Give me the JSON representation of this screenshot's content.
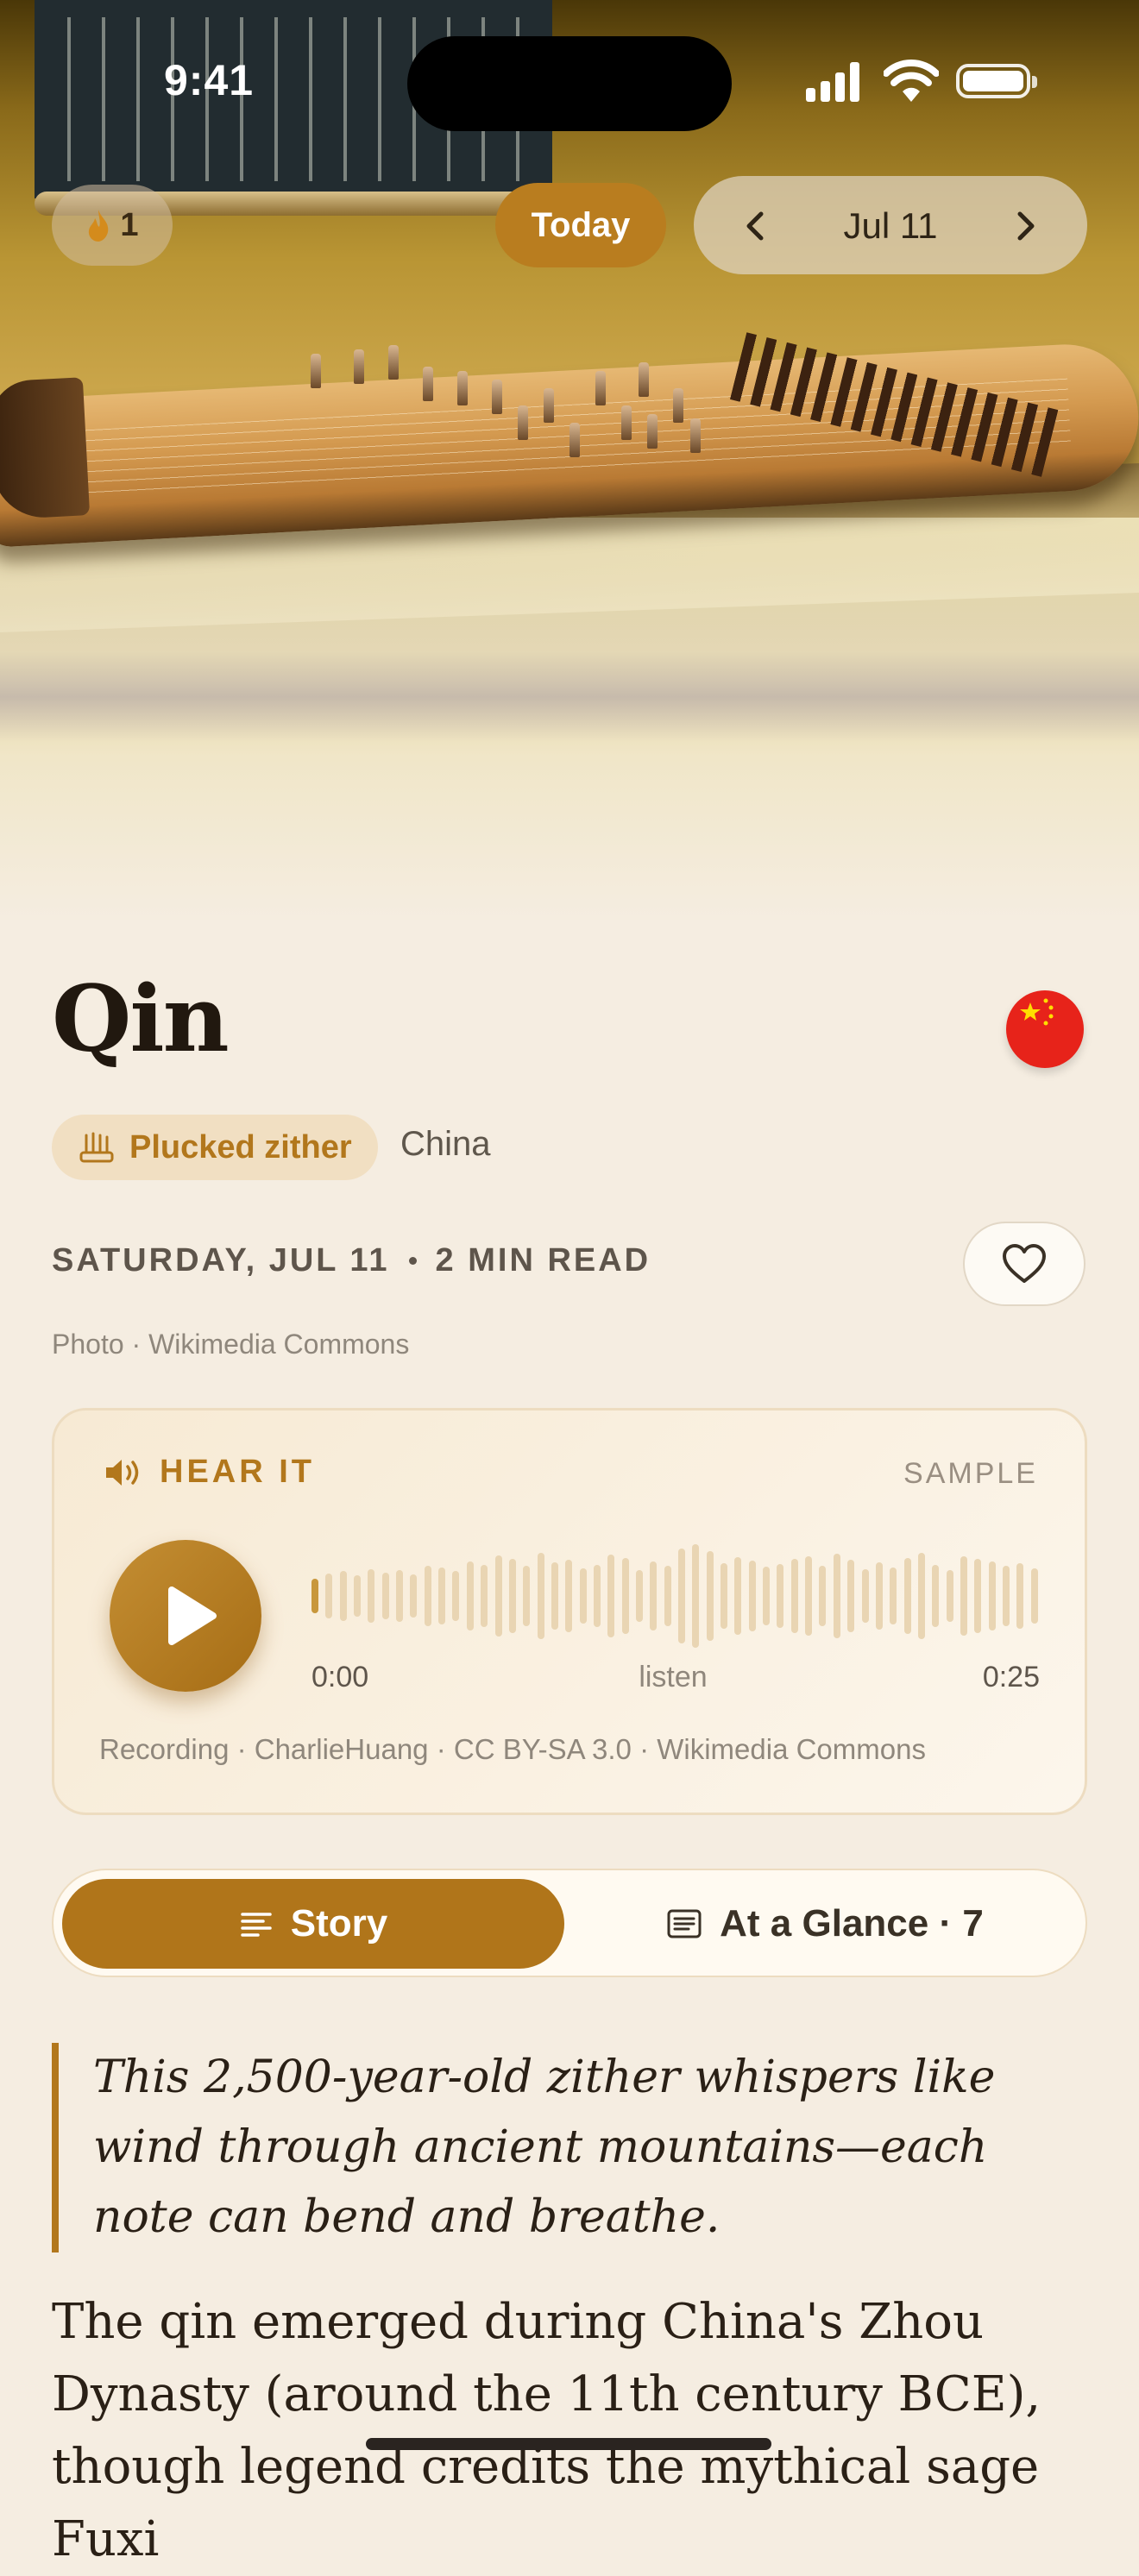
{
  "status_bar": {
    "time": "9:41"
  },
  "top_bar": {
    "streak_count": "1",
    "today_label": "Today",
    "date_label": "Jul 11"
  },
  "article": {
    "title": "Qin",
    "category": "Plucked zither",
    "country": "China",
    "flag": "china-flag",
    "date_line": "SATURDAY, JUL 11",
    "read_time": "2 MIN READ",
    "photo_credit": "Photo · Wikimedia Commons",
    "favorited": false
  },
  "audio": {
    "heading": "HEAR IT",
    "badge": "SAMPLE",
    "current_time": "0:00",
    "center_label": "listen",
    "duration": "0:25",
    "progress": 0.0,
    "attribution": "Recording · CharlieHuang · CC BY-SA 3.0 · Wikimedia Commons"
  },
  "tabs": {
    "story_label": "Story",
    "glance_label": "At a Glance · 7",
    "selected": "Story"
  },
  "story": {
    "pull_quote": "This 2,500-year-old zither whispers like wind through ancient mountains—each note can bend and breathe.",
    "paragraph": "The qin emerged during China's Zhou Dynasty (around the 11th century BCE), though legend credits the mythical sage Fuxi"
  },
  "colors": {
    "accent": "#b0751a",
    "background": "#f5ede1",
    "text": "#21180f"
  }
}
